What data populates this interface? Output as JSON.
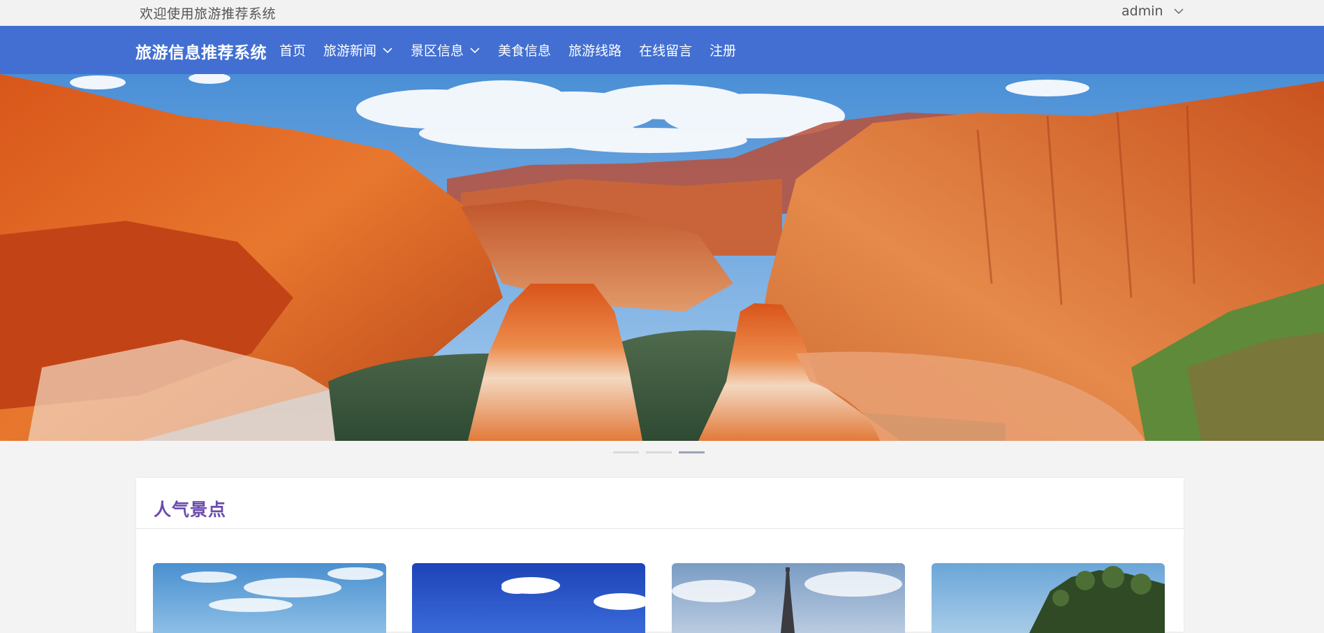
{
  "topbar": {
    "welcome": "欢迎使用旅游推荐系统",
    "user": "admin"
  },
  "navbar": {
    "brand": "旅游信息推荐系统",
    "items": [
      {
        "label": "首页",
        "dropdown": false
      },
      {
        "label": "旅游新闻",
        "dropdown": true
      },
      {
        "label": "景区信息",
        "dropdown": true
      },
      {
        "label": "美食信息",
        "dropdown": false
      },
      {
        "label": "旅游线路",
        "dropdown": false
      },
      {
        "label": "在线留言",
        "dropdown": false
      },
      {
        "label": "注册",
        "dropdown": false
      }
    ],
    "color": "#426fd1"
  },
  "carousel": {
    "slides": 3,
    "active_index": 2
  },
  "popular": {
    "title": "人气景点",
    "title_color": "#6b4bab",
    "cards": [
      {
        "image": "sky-clouds"
      },
      {
        "image": "blue-sky-cloud"
      },
      {
        "image": "eiffel-tower"
      },
      {
        "image": "tropical-hill"
      }
    ]
  }
}
